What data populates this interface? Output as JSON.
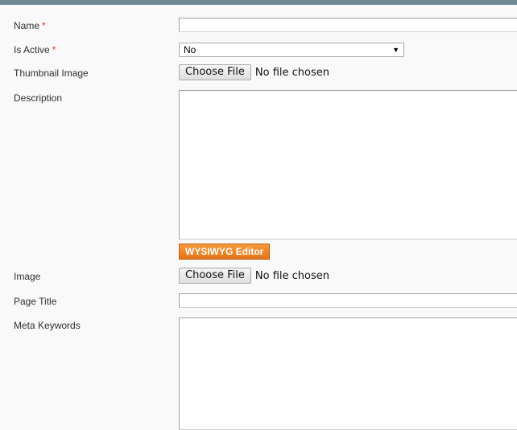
{
  "form": {
    "name": {
      "label": "Name",
      "required_mark": "*",
      "value": ""
    },
    "is_active": {
      "label": "Is Active",
      "required_mark": "*",
      "selected": "No"
    },
    "thumbnail": {
      "label": "Thumbnail Image",
      "button": "Choose File",
      "status": "No file chosen"
    },
    "description": {
      "label": "Description",
      "value": ""
    },
    "wysiwyg_button": "WYSIWYG Editor",
    "image": {
      "label": "Image",
      "button": "Choose File",
      "status": "No file chosen"
    },
    "page_title": {
      "label": "Page Title",
      "value": ""
    },
    "meta_keywords": {
      "label": "Meta Keywords",
      "value": ""
    }
  },
  "colors": {
    "topbar": "#6f8992",
    "required": "#eb340a",
    "wysiwyg_button": "#f08a2a"
  },
  "icons": {
    "select_arrow": "chevron-down-icon"
  }
}
